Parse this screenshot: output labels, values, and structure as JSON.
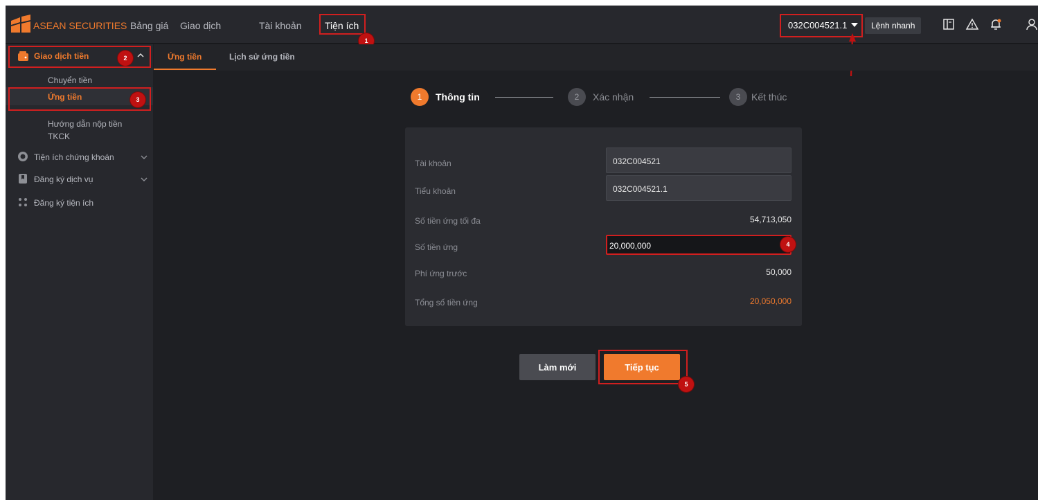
{
  "topbar": {
    "brand": "ASEAN SECURITIES",
    "nav": [
      "Bảng giá",
      "Giao dịch",
      "Tài khoản",
      "Tiện ích"
    ],
    "account": "032C004521.1",
    "quick_order": "Lệnh nhanh"
  },
  "annotations": [
    "1",
    "2",
    "3",
    "4",
    "5"
  ],
  "sidebar": {
    "group_money": "Giao dịch tiền",
    "items": [
      "Chuyển tiền",
      "Ứng tiền",
      "Hướng dẫn nộp tiền",
      "TKCK"
    ],
    "group_stock": "Tiện ích chứng khoán",
    "group_service": "Đăng ký dịch vụ",
    "group_utility": "Đăng ký tiện ích"
  },
  "tabs": [
    "Ứng tiền",
    "Lịch sử ứng tiền"
  ],
  "steps": [
    {
      "num": "1",
      "label": "Thông tin"
    },
    {
      "num": "2",
      "label": "Xác nhận"
    },
    {
      "num": "3",
      "label": "Kết thúc"
    }
  ],
  "form": {
    "account_label": "Tài khoản",
    "account_value": "032C004521",
    "subaccount_label": "Tiểu khoản",
    "subaccount_value": "032C004521.1",
    "max_label": "Số tiền ứng tối đa",
    "max_value": "54,713,050",
    "amount_label": "Số tiền ứng",
    "amount_value": "20,000,000",
    "fee_label": "Phí ứng trước",
    "fee_value": "50,000",
    "total_label": "Tổng số tiền ứng",
    "total_value": "20,050,000"
  },
  "buttons": {
    "reset": "Làm mới",
    "continue": "Tiếp tục"
  },
  "colors": {
    "accent": "#f07a2d",
    "background": "#1e1f23",
    "annotation": "#c01111"
  }
}
